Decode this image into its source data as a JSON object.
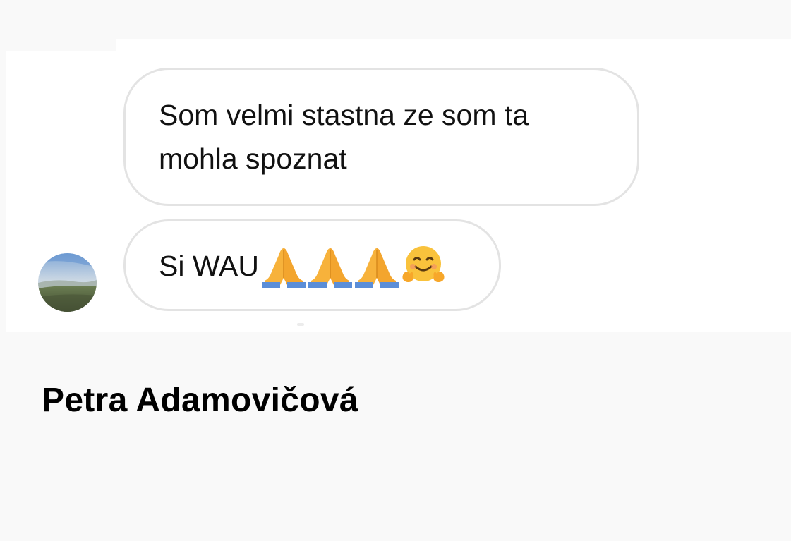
{
  "conversation": {
    "messages": [
      {
        "lines": [
          "Som velmi stastna ze som ta",
          "mohla spoznat"
        ]
      },
      {
        "text": "Si WAU",
        "emojis": [
          "folded-hands-emoji",
          "folded-hands-emoji",
          "folded-hands-emoji",
          "hugging-face-emoji"
        ]
      }
    ],
    "avatar": {
      "icon": "avatar-landscape-photo"
    }
  },
  "caption": {
    "name": "Petra Adamovičová"
  },
  "colors": {
    "background": "#f9f9f9",
    "bubble_border": "#e3e3e3",
    "bubble_fill": "#ffffff",
    "text": "#111111",
    "emoji_skin": "#f7b23b",
    "emoji_sleeve": "#5b8ed8"
  }
}
